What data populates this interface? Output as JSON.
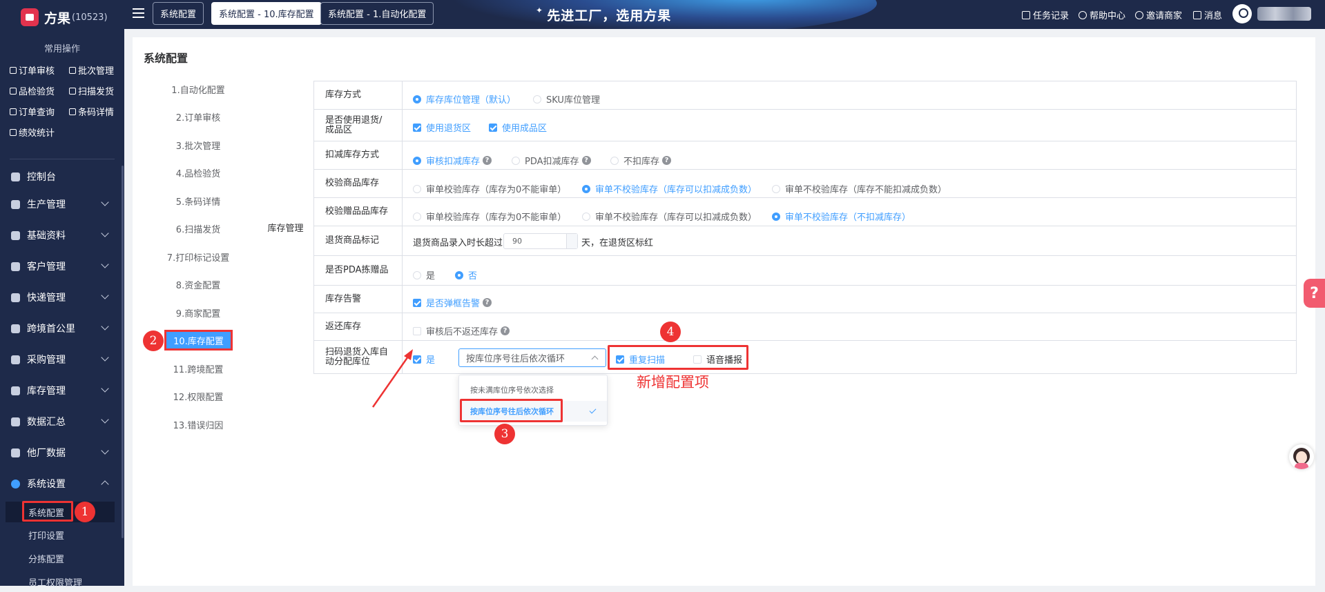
{
  "app": {
    "name": "方果",
    "account_num": "(10523)"
  },
  "sidebar": {
    "quick_title": "常用操作",
    "quick_items": [
      "订单审核",
      "批次管理",
      "品检验货",
      "扫描发货",
      "订单查询",
      "条码详情",
      "绩效统计"
    ],
    "menu": [
      {
        "label": "控制台",
        "icon": "dashboard-icon",
        "expandable": false
      },
      {
        "label": "生产管理",
        "icon": "production-icon",
        "expandable": true
      },
      {
        "label": "基础资料",
        "icon": "database-icon",
        "expandable": true
      },
      {
        "label": "客户管理",
        "icon": "customer-icon",
        "expandable": true
      },
      {
        "label": "快递管理",
        "icon": "express-icon",
        "expandable": true
      },
      {
        "label": "跨境首公里",
        "icon": "globe-icon",
        "expandable": true
      },
      {
        "label": "采购管理",
        "icon": "purchase-icon",
        "expandable": true
      },
      {
        "label": "库存管理",
        "icon": "inventory-icon",
        "expandable": true
      },
      {
        "label": "数据汇总",
        "icon": "pie-chart-icon",
        "expandable": true
      },
      {
        "label": "他厂数据",
        "icon": "factory-data-icon",
        "expandable": true
      },
      {
        "label": "系统设置",
        "icon": "settings-icon",
        "expandable": true,
        "open": true
      }
    ],
    "submenu": [
      {
        "label": "系统配置",
        "active": true
      },
      {
        "label": "打印设置"
      },
      {
        "label": "分拣配置"
      },
      {
        "label": "员工权限管理"
      }
    ]
  },
  "header": {
    "tabs": [
      "系统配置",
      "系统配置 - 10.库存配置",
      "系统配置 - 1.自动化配置"
    ],
    "active_tab": 1,
    "slogan": "先进工厂，选用方果",
    "links": [
      {
        "label": "任务记录",
        "icon": "task-icon"
      },
      {
        "label": "帮助中心",
        "icon": "help-icon"
      },
      {
        "label": "邀请商家",
        "icon": "invite-icon"
      },
      {
        "label": "消息",
        "icon": "message-icon"
      }
    ]
  },
  "page": {
    "title": "系统配置",
    "nav": [
      "1.自动化配置",
      "2.订单审核",
      "3.批次管理",
      "4.品检验货",
      "5.条码详情",
      "6.扫描发货",
      "7.打印标记设置",
      "8.资金配置",
      "9.商家配置",
      "10.库存配置",
      "11.跨境配置",
      "12.权限配置",
      "13.错误归因"
    ],
    "active_nav": 9
  },
  "config": {
    "group": "库存管理",
    "rows": {
      "stock_mode": {
        "label": "库存方式",
        "options": [
          "库存库位管理（默认）",
          "SKU库位管理"
        ],
        "selected": 0
      },
      "return_area": {
        "label": "是否使用退货/成品区",
        "options": [
          "使用退货区",
          "使用成品区"
        ],
        "checked": [
          true,
          true
        ]
      },
      "deduct_mode": {
        "label": "扣减库存方式",
        "options": [
          "审核扣减库存",
          "PDA扣减库存",
          "不扣库存"
        ],
        "selected": 0
      },
      "verify_goods": {
        "label": "校验商品库存",
        "options": [
          "审单校验库存（库存为0不能审单）",
          "审单不校验库存（库存可以扣减成负数）",
          "审单不校验库存（库存不能扣减成负数）"
        ],
        "selected": 1
      },
      "verify_gift": {
        "label": "校验赠品品库存",
        "options": [
          "审单校验库存（库存为0不能审单）",
          "审单不校验库存（库存可以扣减成负数）",
          "审单不校验库存（不扣减库存）"
        ],
        "selected": 2
      },
      "return_mark": {
        "label": "退货商品标记",
        "prefix": "退货商品录入时长超过",
        "value": "90",
        "suffix": "天，在退货区标红"
      },
      "pda_gift": {
        "label": "是否PDA拣赠品",
        "options": [
          "是",
          "否"
        ],
        "selected": 1
      },
      "stock_alert": {
        "label": "库存告警",
        "option": "是否弹框告警",
        "checked": true
      },
      "return_stock": {
        "label": "返还库存",
        "option": "审核后不返还库存",
        "checked": false
      },
      "scan_return": {
        "label": "扫码退货入库自动分配库位",
        "yes_label": "是",
        "yes_checked": true,
        "select_value": "按库位序号往后依次循环",
        "dropdown": [
          "按未满库位序号依次选择",
          "按库位序号往后依次循环"
        ],
        "dropdown_selected": 1,
        "repeat_scan": {
          "label": "重复扫描",
          "checked": true
        },
        "voice": {
          "label": "语音播报",
          "checked": false
        }
      }
    }
  },
  "annotations": {
    "badges": [
      "1",
      "2",
      "3",
      "4"
    ],
    "new_items_note": "新增配置项"
  },
  "colors": {
    "accent": "#409eff",
    "sidebar": "#1e2a4a",
    "annotation": "#e33333"
  }
}
